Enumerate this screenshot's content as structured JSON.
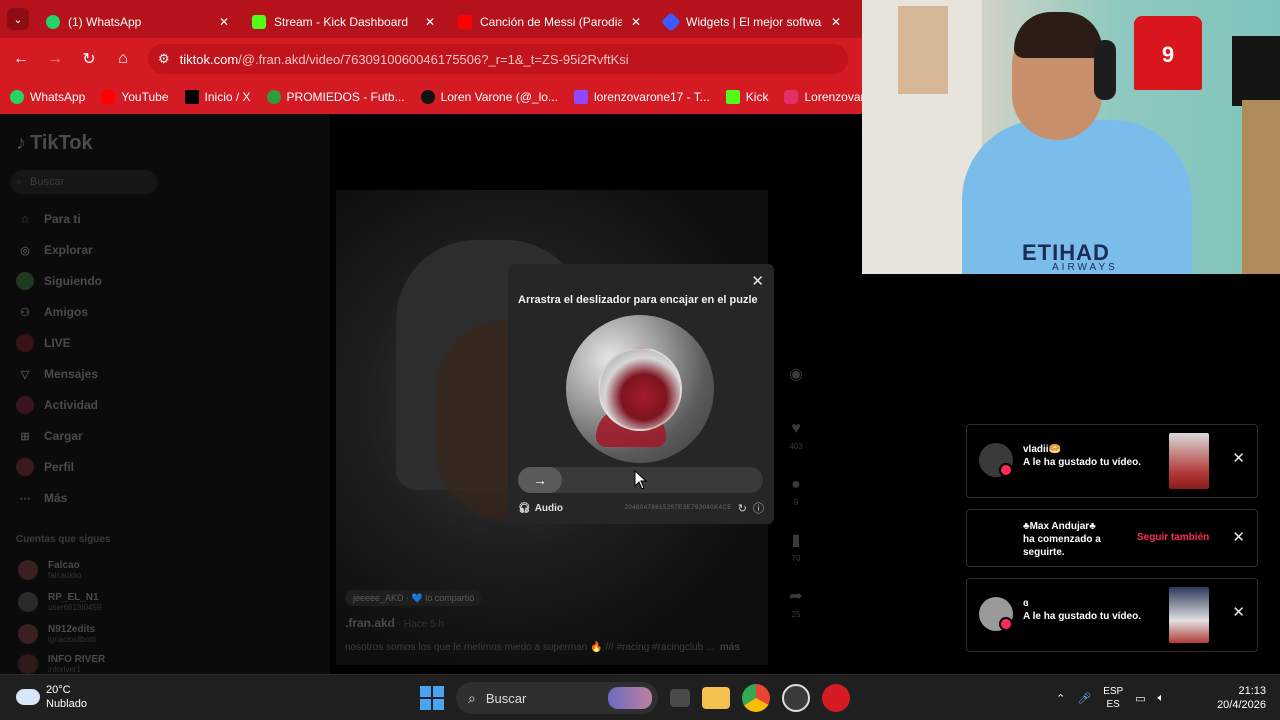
{
  "browser": {
    "tabs": [
      {
        "label": "(1) WhatsApp",
        "icon": "whatsapp-icon",
        "color": "#25d366"
      },
      {
        "label": "Stream - Kick Dashboard",
        "icon": "kick-icon",
        "color": "#53fc18"
      },
      {
        "label": "Canción de Messi (Parodia L",
        "icon": "youtube-icon",
        "color": "#ff0000"
      },
      {
        "label": "Widgets | El mejor software",
        "icon": "widgets-icon",
        "color": "#3d5afe"
      }
    ],
    "url_host": "tiktok.com",
    "url_path": "/@.fran.akd/video/7630910060046175506?_r=1&_t=ZS-95i2RvftKsi",
    "bookmarks": [
      {
        "label": "WhatsApp",
        "icon": "whatsapp-icon",
        "color": "#25d366"
      },
      {
        "label": "YouTube",
        "icon": "youtube-icon",
        "color": "#ff0000"
      },
      {
        "label": "Inicio / X",
        "icon": "x-icon",
        "color": "#000000"
      },
      {
        "label": "PROMIEDOS - Futb...",
        "icon": "promiedos-icon",
        "color": "#2e9e3a"
      },
      {
        "label": "Loren Varone (@_lo...",
        "icon": "tiktok-icon",
        "color": "#111111"
      },
      {
        "label": "lorenzovarone17 - T...",
        "icon": "twitch-icon",
        "color": "#9146ff"
      },
      {
        "label": "Kick",
        "icon": "kick-icon",
        "color": "#53fc18"
      },
      {
        "label": "Lorenzovarone (In",
        "icon": "instagram-icon",
        "color": "#e1306c"
      }
    ]
  },
  "tiktok": {
    "logo": "TikTok",
    "search_placeholder": "Buscar",
    "nav": [
      {
        "label": "Para ti",
        "icon": "home-icon"
      },
      {
        "label": "Explorar",
        "icon": "compass-icon"
      },
      {
        "label": "Siguiendo",
        "icon": "following-icon"
      },
      {
        "label": "Amigos",
        "icon": "friends-icon"
      },
      {
        "label": "LIVE",
        "icon": "live-icon"
      },
      {
        "label": "Mensajes",
        "icon": "messages-icon"
      },
      {
        "label": "Actividad",
        "icon": "activity-icon"
      },
      {
        "label": "Cargar",
        "icon": "upload-icon"
      },
      {
        "label": "Perfil",
        "icon": "profile-icon"
      },
      {
        "label": "Más",
        "icon": "more-icon"
      }
    ],
    "following_title": "Cuentas que sigues",
    "following": [
      {
        "name": "Falcao",
        "handle": "falcaoklio"
      },
      {
        "name": "RP_EL_N1",
        "handle": "user6813I0459"
      },
      {
        "name": "N912edits",
        "handle": "ignaciosilbotti"
      },
      {
        "name": "INFO RIVER",
        "handle": "inforiver1"
      }
    ],
    "video": {
      "repost_pill": "jeeeee_AKD · 💙 lo compartió",
      "author": ".fran.akd",
      "time": " · Hace 5 h",
      "description": "nosotros somos los que le metimos miedo a superman 🔥 /// #racing #racingclub ...",
      "more": "más",
      "likes": "403",
      "comments": "9",
      "saves": "70",
      "shares": "25"
    }
  },
  "captcha": {
    "title": "Arrastra el deslizador para encajar en el puzle",
    "close": "✕",
    "audio_label": "Audio",
    "code": "20460478815297E3E793040K4CE",
    "slider_progress": 0
  },
  "notifications": [
    {
      "name": "vladii🥯",
      "message": "A le ha gustado tu vídeo.",
      "has_thumb": true
    },
    {
      "name": "♣Max Andujar♣",
      "message": "ha comenzado a seguirte.",
      "action": "Seguir también"
    },
    {
      "name": "ɞ",
      "message": "A le ha gustado tu vídeo.",
      "has_thumb": true
    }
  ],
  "webcam": {
    "jersey_number": "9",
    "shirt_text": "ETIHAD",
    "shirt_sub": "AIRWAYS"
  },
  "taskbar": {
    "temperature": "20°C",
    "weather": "Nublado",
    "search": "Buscar",
    "lang_top": "ESP",
    "lang_bottom": "ES",
    "time": "21:13",
    "date": "20/4/2026"
  }
}
